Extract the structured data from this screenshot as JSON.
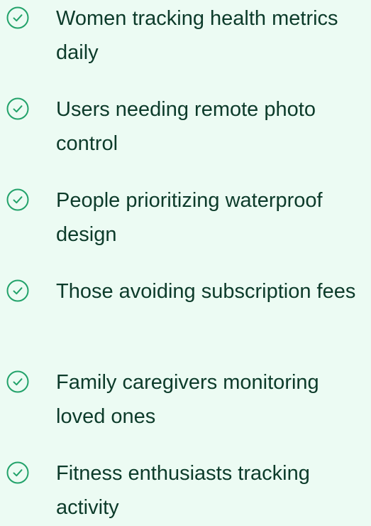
{
  "accent_color": "#22a26a",
  "text_color": "#0c3b2a",
  "background_color": "#ecfbf3",
  "list": {
    "items": [
      {
        "icon": "check-circle-icon",
        "label": "Women tracking health metrics daily"
      },
      {
        "icon": "check-circle-icon",
        "label": "Users needing remote photo control"
      },
      {
        "icon": "check-circle-icon",
        "label": "People prioritizing waterproof design"
      },
      {
        "icon": "check-circle-icon",
        "label": "Those avoiding subscription fees"
      },
      {
        "icon": "check-circle-icon",
        "label": "Family caregivers monitoring loved ones"
      },
      {
        "icon": "check-circle-icon",
        "label": "Fitness enthusiasts tracking activity"
      }
    ]
  }
}
